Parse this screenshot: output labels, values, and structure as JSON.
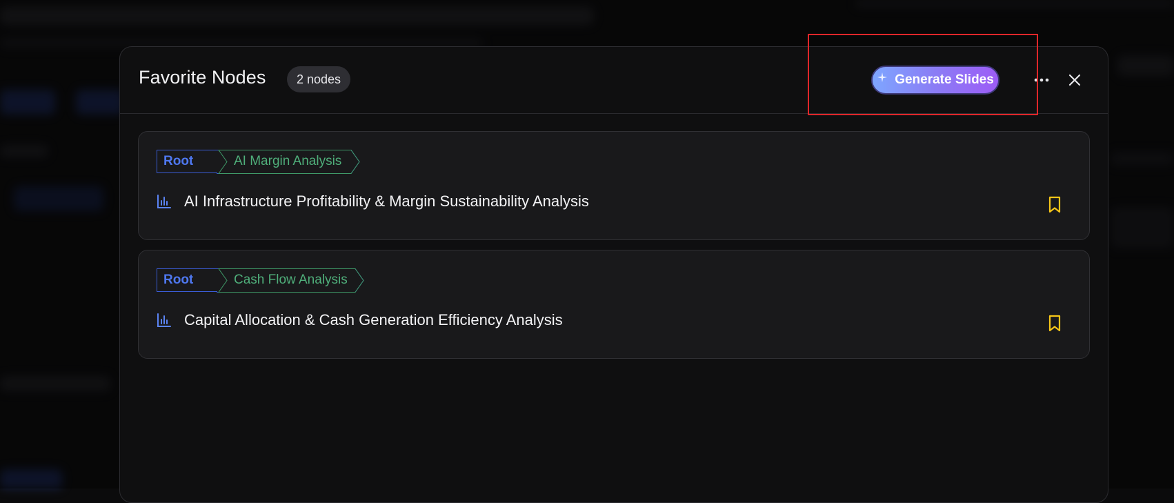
{
  "modal": {
    "title": "Favorite Nodes",
    "count_badge": "2 nodes",
    "generate_label": "Generate Slides"
  },
  "nodes": [
    {
      "crumb_root": "Root",
      "crumb_parent": "AI Margin Analysis",
      "title": "AI Infrastructure Profitability & Margin Sustainability Analysis"
    },
    {
      "crumb_root": "Root",
      "crumb_parent": "Cash Flow Analysis",
      "title": "Capital Allocation & Cash Generation Efficiency Analysis"
    }
  ],
  "icons": {
    "node_type": "bar-chart-icon",
    "bookmark": "bookmark-icon",
    "more": "more-horizontal-icon",
    "close": "close-icon",
    "sparkle": "sparkle-icon"
  },
  "colors": {
    "root_crumb": "#4f78f0",
    "parent_crumb": "#4fae7a",
    "bookmark": "#f5c518",
    "chart_icon": "#5b84f5",
    "annotation": "#e0262a"
  }
}
